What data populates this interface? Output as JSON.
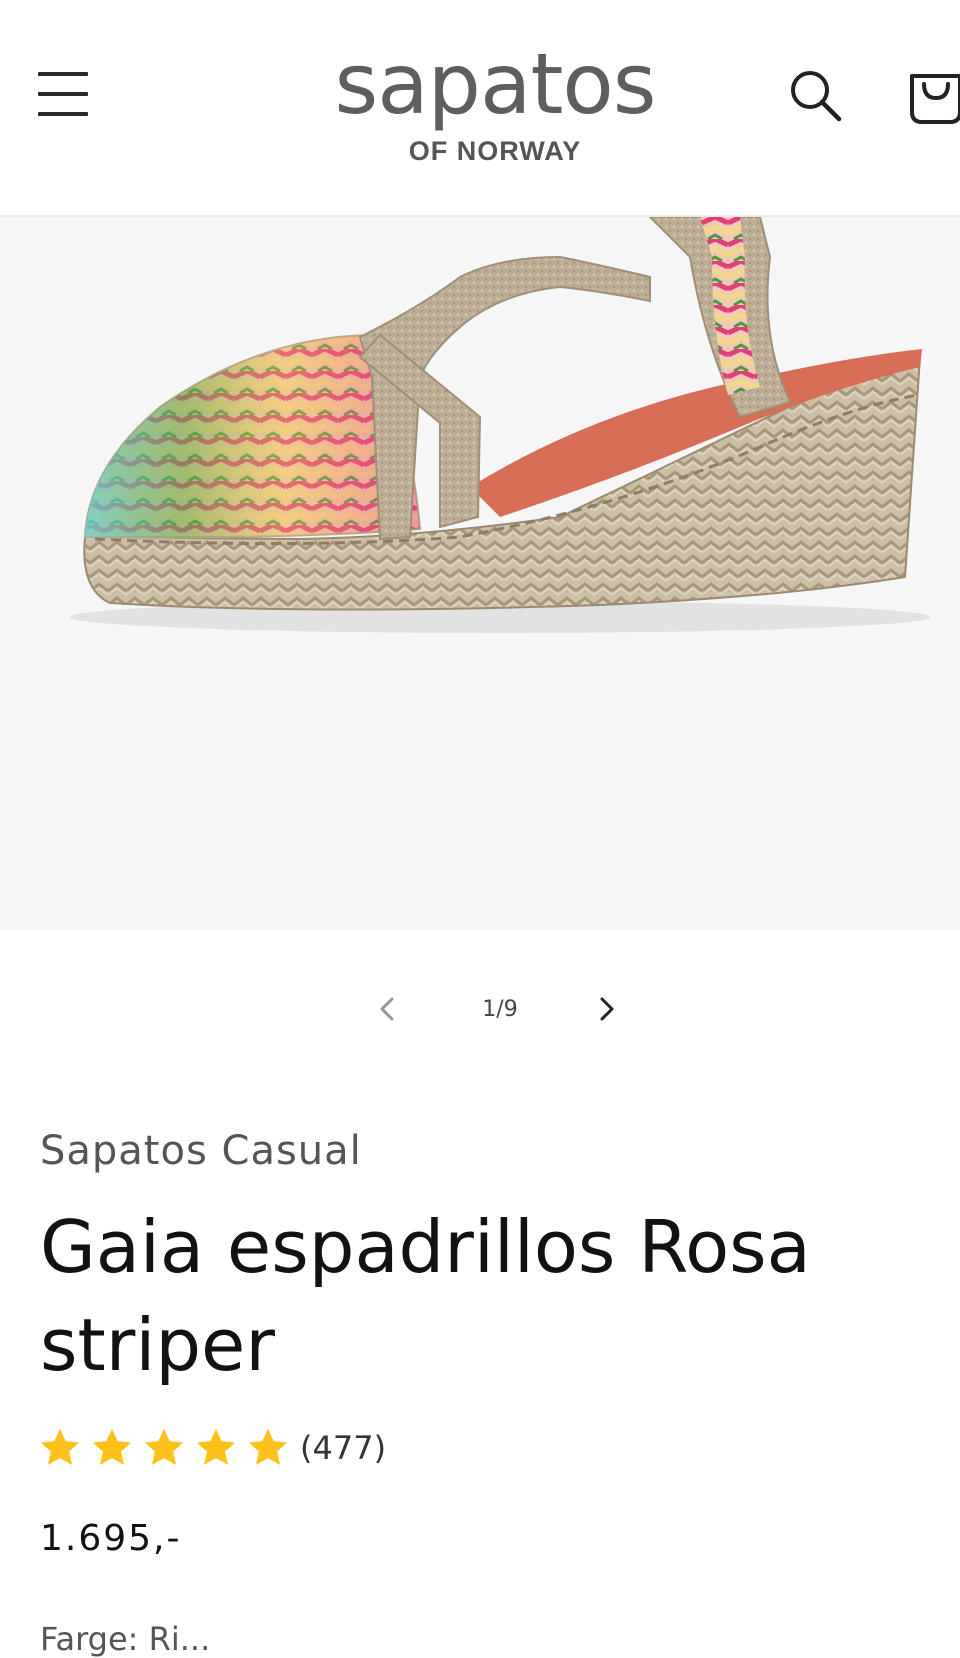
{
  "header": {
    "logo_word": "sapatos",
    "logo_sub": "OF NORWAY",
    "menu_icon": "hamburger-menu-icon",
    "search_icon": "search-icon",
    "cart_icon": "cart-icon"
  },
  "gallery": {
    "image_alt": "Gaia espadrillos Rosa striper",
    "current": 1,
    "total": 9,
    "counter_text": "1/9",
    "prev_icon": "chevron-left-icon",
    "next_icon": "chevron-right-icon"
  },
  "product": {
    "vendor": "Sapatos Casual",
    "title": "Gaia espadrillos Rosa striper",
    "rating": 5,
    "rating_max": 5,
    "review_count": "(477)",
    "price": "1.695,-",
    "next_line_partial": "Farge: Ri..."
  },
  "colors": {
    "star": "#ffc21a",
    "text": "#121212",
    "muted": "#555555",
    "gallery_bg": "#f6f6f7"
  }
}
